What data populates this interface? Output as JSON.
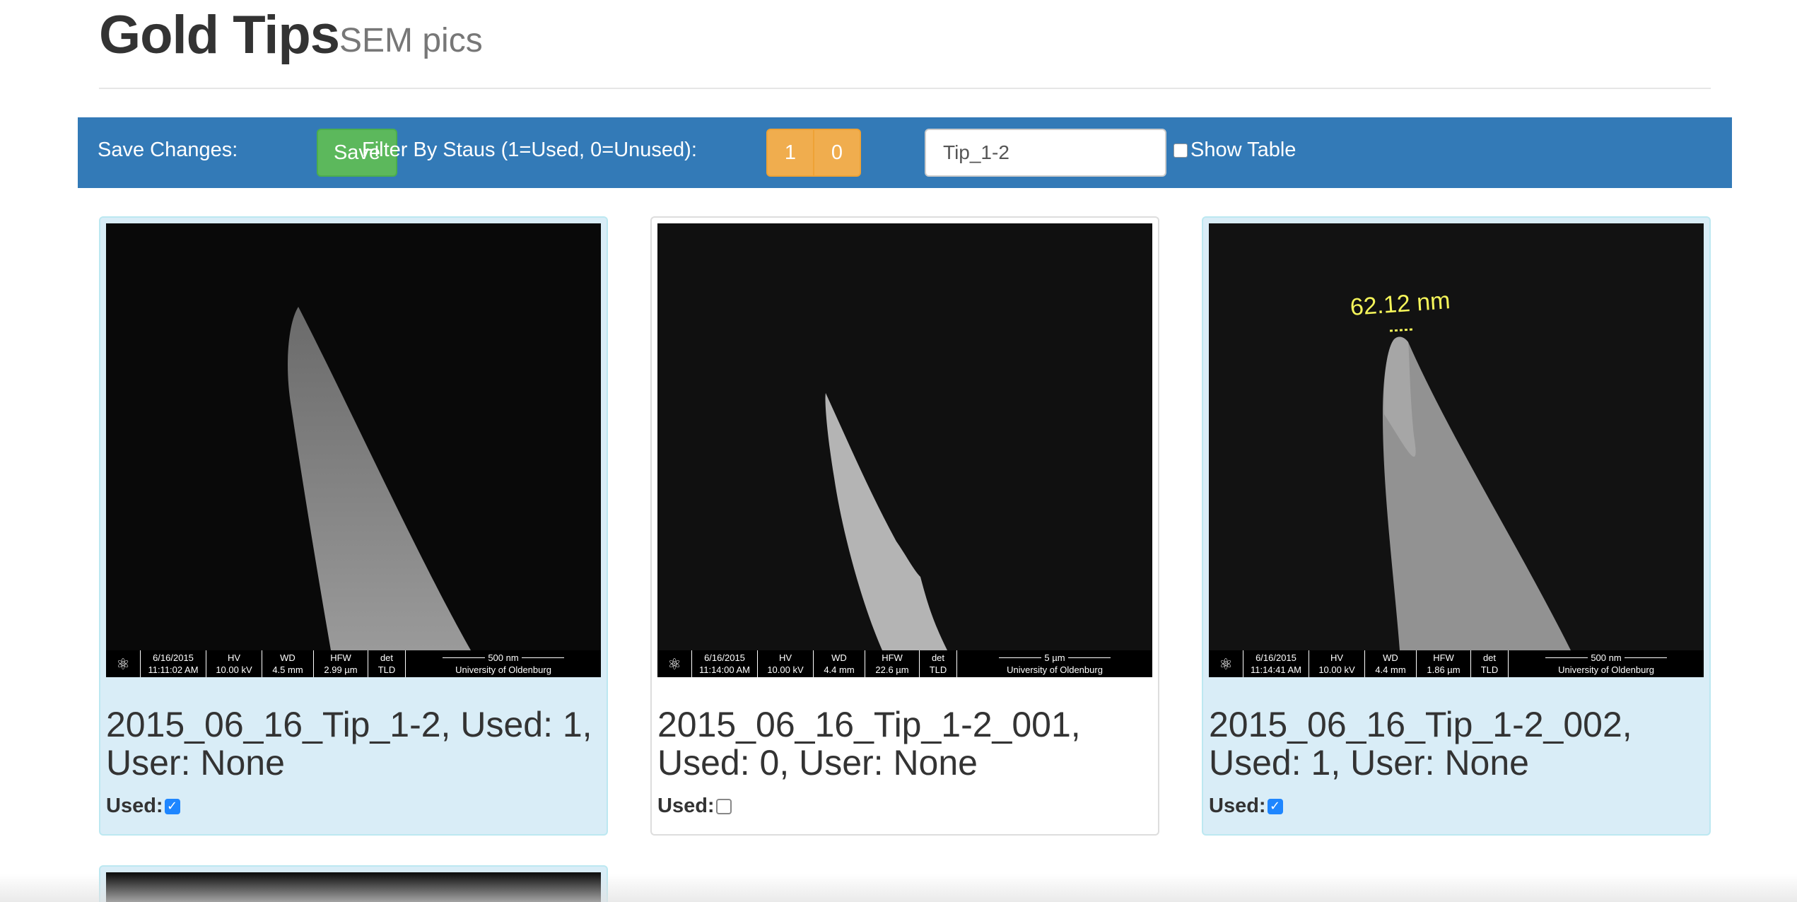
{
  "header": {
    "title": "Gold Tips",
    "subtitle": "SEM pics"
  },
  "toolbar": {
    "save_changes_label": "Save Changes:",
    "save_button": "Save",
    "filter_label": "Filter By Staus (1=Used, 0=Unused):",
    "filter_options": [
      "1",
      "0"
    ],
    "search_value": "Tip_1-2",
    "show_table_label": "Show Table"
  },
  "cards": [
    {
      "caption": "2015_06_16_Tip_1-2, Used: 1, User: None",
      "used_label": "Used:",
      "used": true,
      "sem": {
        "date": "6/16/2015",
        "time": "11:11:02 AM",
        "hv_label": "HV",
        "hv": "10.00 kV",
        "wd_label": "WD",
        "wd": "4.5 mm",
        "hfw_label": "HFW",
        "hfw": "2.99 µm",
        "det_label": "det",
        "det": "TLD",
        "scale": "500 nm",
        "institution": "University of Oldenburg"
      }
    },
    {
      "caption": "2015_06_16_Tip_1-2_001, Used: 0, User: None",
      "used_label": "Used:",
      "used": false,
      "sem": {
        "date": "6/16/2015",
        "time": "11:14:00 AM",
        "hv_label": "HV",
        "hv": "10.00 kV",
        "wd_label": "WD",
        "wd": "4.4 mm",
        "hfw_label": "HFW",
        "hfw": "22.6 µm",
        "det_label": "det",
        "det": "TLD",
        "scale": "5 µm",
        "institution": "University of Oldenburg"
      }
    },
    {
      "caption": "2015_06_16_Tip_1-2_002, Used: 1, User: None",
      "used_label": "Used:",
      "used": true,
      "annotation": "62.12 nm",
      "sem": {
        "date": "6/16/2015",
        "time": "11:14:41 AM",
        "hv_label": "HV",
        "hv": "10.00 kV",
        "wd_label": "WD",
        "wd": "4.4 mm",
        "hfw_label": "HFW",
        "hfw": "1.86 µm",
        "det_label": "det",
        "det": "TLD",
        "scale": "500 nm",
        "institution": "University of Oldenburg"
      }
    }
  ],
  "colors": {
    "toolbar_bg": "#337ab7",
    "save_green": "#5cb85c",
    "filter_orange": "#f0ad4e",
    "card_used_bg": "#d9edf7",
    "checkbox_blue": "#1e86ff",
    "annotation_yellow": "#f5f55a"
  },
  "icons": [
    "atom-logo-icon",
    "checkbox-icon"
  ]
}
